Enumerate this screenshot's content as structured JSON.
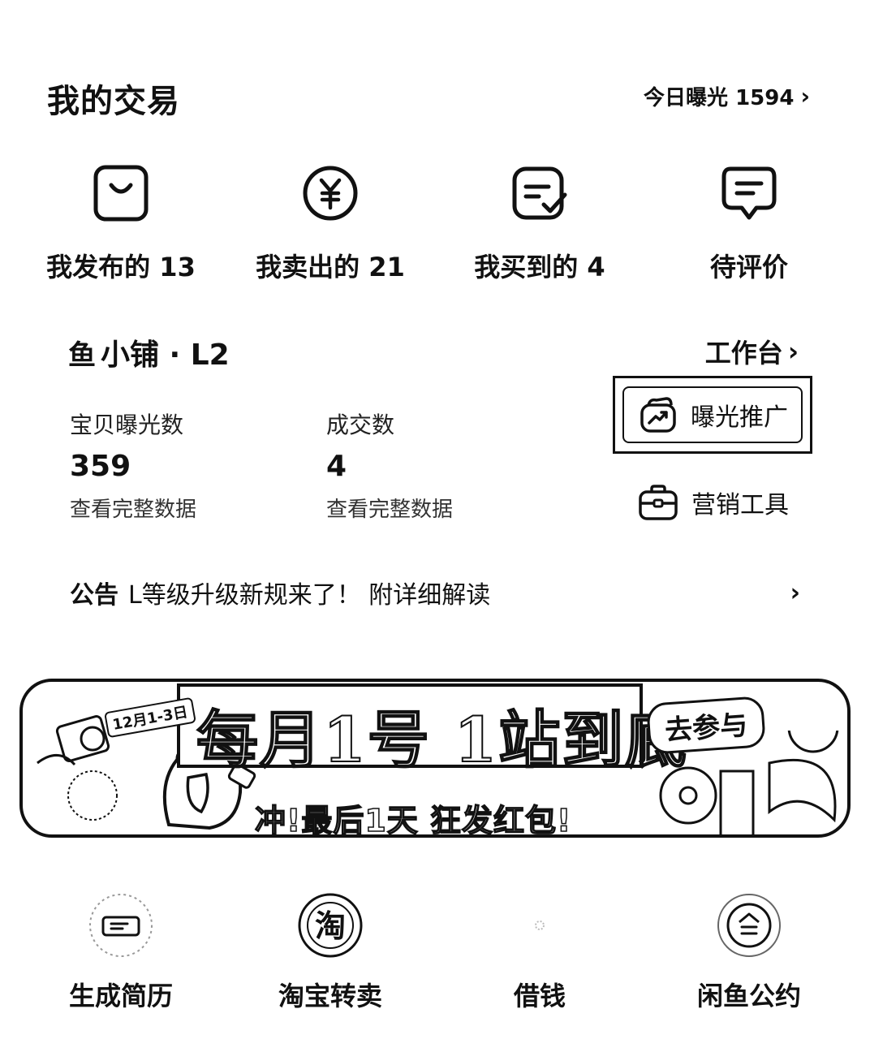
{
  "header": {
    "title": "我的交易",
    "exposure_label": "今日曝光 1594",
    "exposure_chevron": "›"
  },
  "trade": {
    "items": [
      {
        "label": "我发布的 13",
        "icon": "shopping-bag-icon"
      },
      {
        "label": "我卖出的 21",
        "icon": "yuan-coin-icon"
      },
      {
        "label": "我买到的 4",
        "icon": "order-check-icon"
      },
      {
        "label": "待评价",
        "icon": "comment-icon"
      }
    ]
  },
  "shop": {
    "logo": "鱼",
    "title": "小铺 · L2",
    "workbench_label": "工作台",
    "workbench_chevron": "›",
    "stats": [
      {
        "label": "宝贝曝光数",
        "value": "359",
        "link": "查看完整数据"
      },
      {
        "label": "成交数",
        "value": "4",
        "link": "查看完整数据"
      }
    ],
    "promo_label": "曝光推广",
    "tools_label": "营销工具"
  },
  "notice": {
    "tag": "公告",
    "text": "L等级升级新规来了！ 附详细解读",
    "chevron": "›"
  },
  "banner": {
    "date": "12月1-3日",
    "headline": "每月1号 1站到底",
    "cta": "去参与",
    "subline": "冲!最后1天 狂发红包!"
  },
  "quick": {
    "items": [
      {
        "label": "生成简历",
        "icon": "resume-icon"
      },
      {
        "label": "淘宝转卖",
        "icon": "taobao-icon"
      },
      {
        "label": "借钱",
        "icon": "loan-icon"
      },
      {
        "label": "闲鱼公约",
        "icon": "convention-icon"
      }
    ]
  }
}
